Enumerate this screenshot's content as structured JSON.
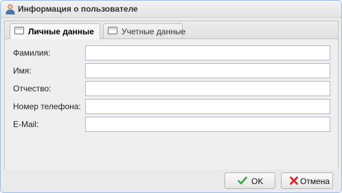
{
  "window": {
    "title": "Информация о пользователе",
    "icon": "user-icon"
  },
  "tabs": [
    {
      "label": "Личные данные",
      "active": true,
      "icon": "tab-icon"
    },
    {
      "label": "Учетные данные",
      "active": false,
      "icon": "tab-icon"
    }
  ],
  "form": {
    "fields": [
      {
        "label": "Фамилия:",
        "value": ""
      },
      {
        "label": "Имя:",
        "value": ""
      },
      {
        "label": "Отчество:",
        "value": ""
      },
      {
        "label": "Номер телефона:",
        "value": ""
      },
      {
        "label": "E-Mail:",
        "value": ""
      }
    ]
  },
  "buttons": {
    "ok": {
      "label": "OK",
      "icon": "checkmark-icon",
      "icon_color": "#3aa53a"
    },
    "cancel": {
      "label": "Отмена",
      "icon": "cross-icon",
      "icon_color": "#d42a2a"
    }
  }
}
